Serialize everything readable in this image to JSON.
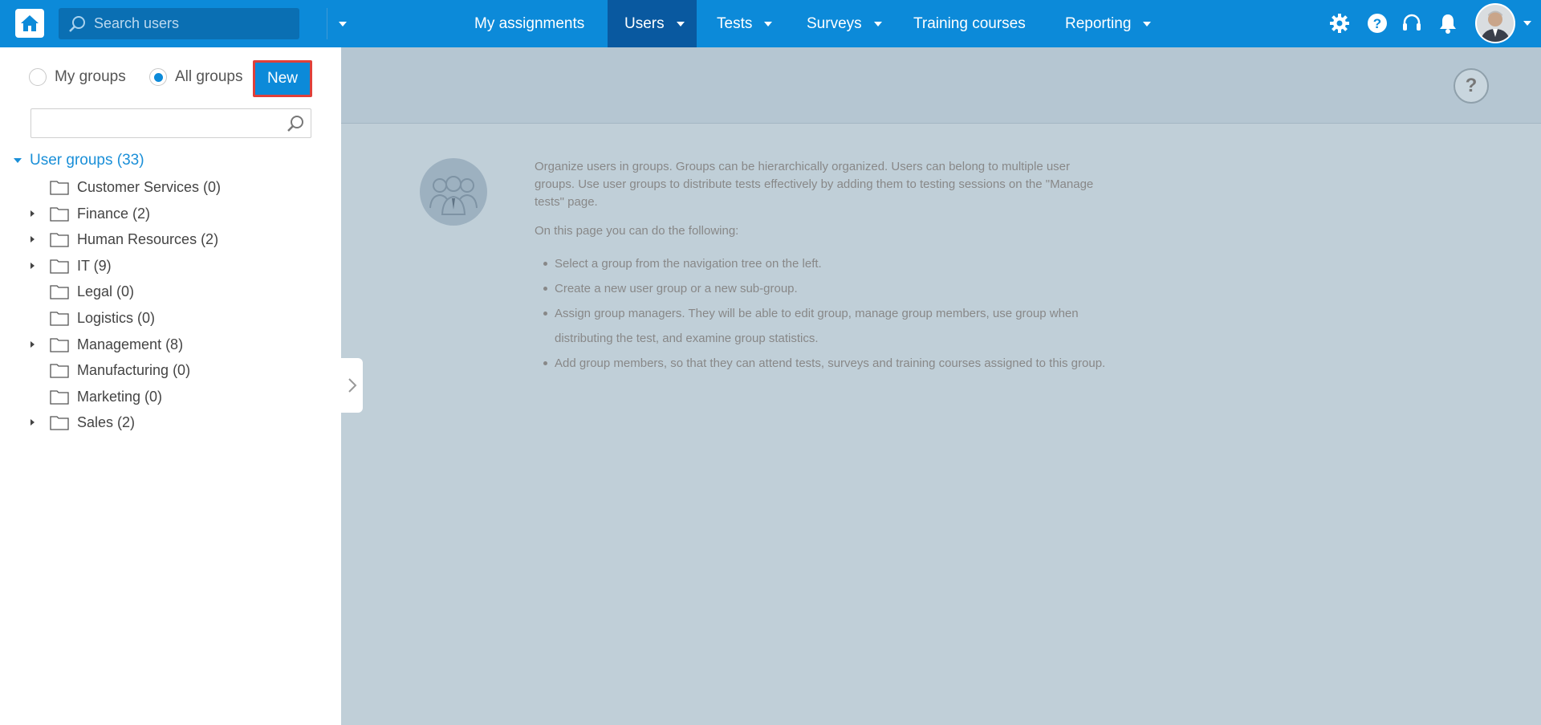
{
  "topbar": {
    "search_placeholder": "Search users",
    "nav": [
      {
        "label": "My assignments"
      },
      {
        "label": "Users"
      },
      {
        "label": "Tests"
      },
      {
        "label": "Surveys"
      },
      {
        "label": "Training courses"
      },
      {
        "label": "Reporting"
      }
    ],
    "icons": [
      "home-icon",
      "search-icon",
      "gear-icon",
      "help-icon",
      "headset-icon",
      "bell-icon",
      "user-avatar"
    ],
    "brand_color": "#0c8ad9"
  },
  "sidebar": {
    "radio_my_groups": "My groups",
    "radio_all_groups": "All groups",
    "selected": "All groups",
    "new_button": "New",
    "root_label": "User groups (33)",
    "groups": [
      {
        "label": "Customer Services (0)",
        "expandable": false
      },
      {
        "label": "Finance (2)",
        "expandable": true
      },
      {
        "label": "Human Resources (2)",
        "expandable": true
      },
      {
        "label": "IT (9)",
        "expandable": true
      },
      {
        "label": "Legal (0)",
        "expandable": false
      },
      {
        "label": "Logistics (0)",
        "expandable": false
      },
      {
        "label": "Management (8)",
        "expandable": true
      },
      {
        "label": "Manufacturing (0)",
        "expandable": false
      },
      {
        "label": "Marketing (0)",
        "expandable": false
      },
      {
        "label": "Sales (2)",
        "expandable": true
      }
    ]
  },
  "main": {
    "help_label": "?",
    "intro": "Organize users in groups. Groups can be hierarchically organized. Users can belong to multiple user groups. Use user groups to distribute tests effectively by adding them to testing sessions on the \"Manage tests\" page.",
    "lead": "On this page you can do the following:",
    "bullets": [
      "Select a group from the navigation tree on the left.",
      "Create a new user group or a new sub-group.",
      "Assign group managers. They will be able to edit group, manage group members, use group when distributing the test, and examine group statistics.",
      "Add group members, so that they can attend tests, surveys and training courses assigned to this group."
    ]
  }
}
